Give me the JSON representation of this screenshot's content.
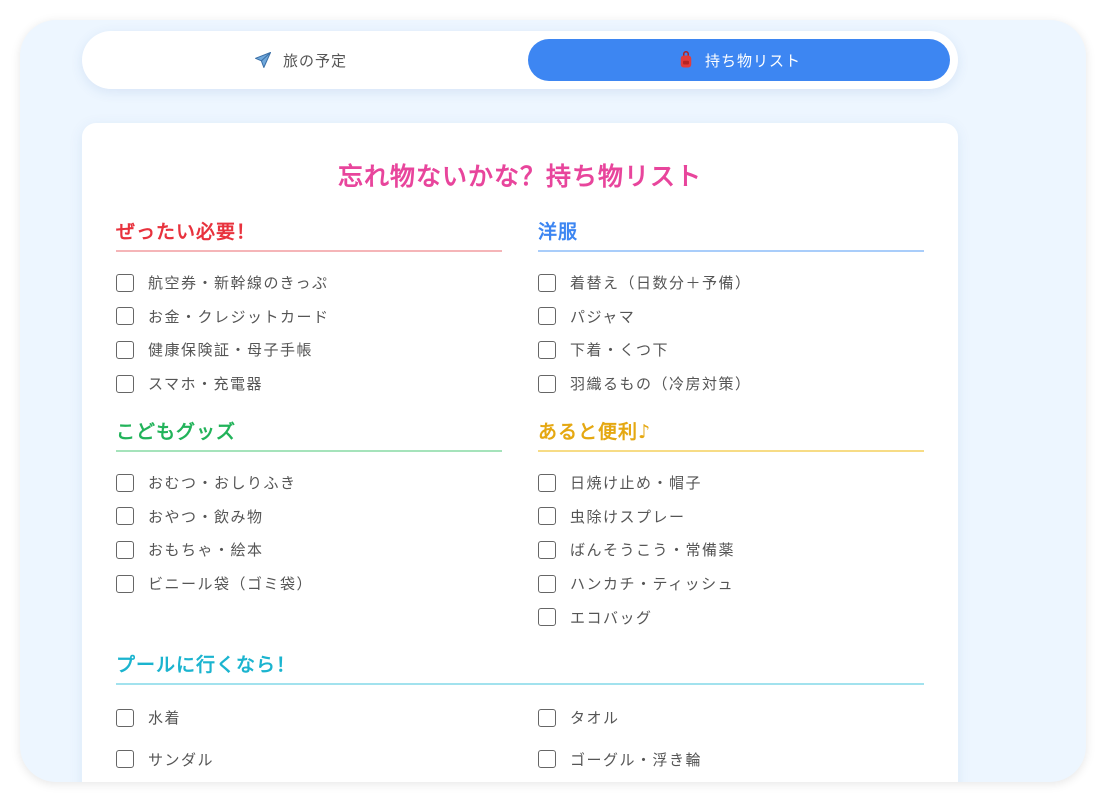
{
  "tabs": [
    {
      "label": "旅の予定",
      "icon": "airplane-icon",
      "active": false
    },
    {
      "label": "持ち物リスト",
      "icon": "backpack-icon",
      "active": true
    }
  ],
  "title": "忘れ物ないかな？持ち物リスト",
  "sections": {
    "essential": {
      "title": "ぜったい必要！",
      "color": "#e8323d",
      "line": "#f5b5b8",
      "items": [
        "航空券・新幹線のきっぷ",
        "お金・クレジットカード",
        "健康保険証・母子手帳",
        "スマホ・充電器"
      ]
    },
    "clothes": {
      "title": "洋服",
      "color": "#3d86f2",
      "line": "#a9cdfa",
      "items": [
        "着替え（日数分＋予備）",
        "パジャマ",
        "下着・くつ下",
        "羽織るもの（冷房対策）"
      ]
    },
    "kids": {
      "title": "こどもグッズ",
      "color": "#22b35a",
      "line": "#a5e3bb",
      "items": [
        "おむつ・おしりふき",
        "おやつ・飲み物",
        "おもちゃ・絵本",
        "ビニール袋（ゴミ袋）"
      ]
    },
    "handy": {
      "title": "あると便利♪",
      "color": "#e5a812",
      "line": "#f7dc86",
      "items": [
        "日焼け止め・帽子",
        "虫除けスプレー",
        "ばんそうこう・常備薬",
        "ハンカチ・ティッシュ",
        "エコバッグ"
      ]
    },
    "pool": {
      "title": "プールに行くなら！",
      "color": "#1bb4cf",
      "line": "#a2e2ee",
      "items": [
        "水着",
        "タオル",
        "サンダル",
        "ゴーグル・浮き輪"
      ]
    }
  },
  "colors": {
    "accent": "#3d86f2",
    "title": "#e8459c",
    "background": "#edf6ff"
  }
}
